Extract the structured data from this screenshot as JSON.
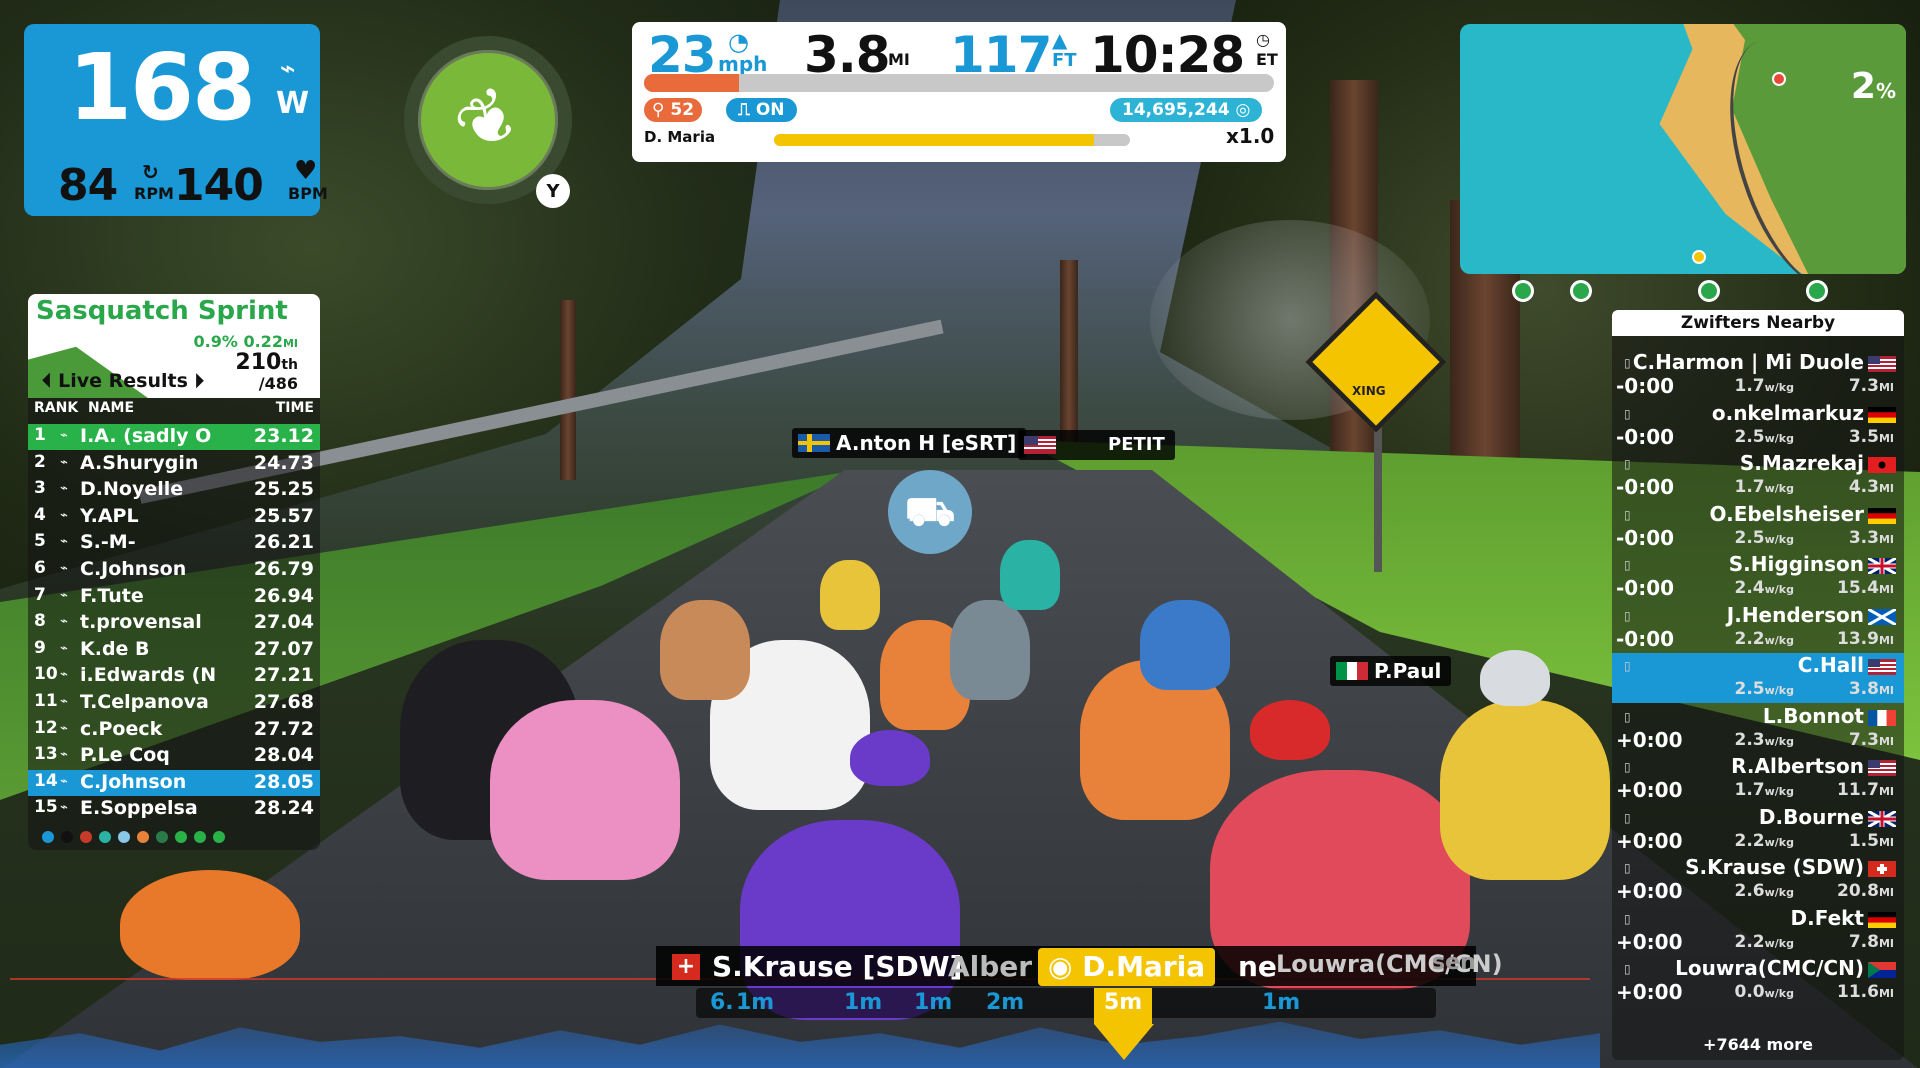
{
  "power": {
    "value": "168",
    "unit": "W",
    "cadence": "84",
    "cadence_unit": "RPM",
    "heart_rate": "140",
    "hr_unit": "BPM"
  },
  "powerup": {
    "key": "Y",
    "icon": "feather-icon"
  },
  "top": {
    "speed": "23",
    "speed_unit": "mph",
    "distance": "3.8",
    "distance_unit": "MI",
    "elevation": "117",
    "elevation_unit": "FT",
    "time": "10:28",
    "time_unit": "ET",
    "route_progress_pct": 15,
    "cadence_pill": "52",
    "steering": "ON",
    "xp": "14,695,244",
    "rider": "D. Maria",
    "level_progress_pct": 90,
    "multiplier": "x1.0"
  },
  "minimap": {
    "gradient": "2",
    "gradient_unit": "%"
  },
  "leaderboard": {
    "title": "Sasquatch Sprint",
    "segment_pct": "0.9%",
    "segment_dist": "0.22",
    "segment_dist_unit": "MI",
    "position": "210",
    "position_suffix": "th",
    "of_total": "/486",
    "live_label": "Live Results",
    "col_rank": "RANK",
    "col_name": "NAME",
    "col_time": "TIME",
    "rows": [
      {
        "rank": "1",
        "name": "I.A. (sadly O",
        "time": "23.12"
      },
      {
        "rank": "2",
        "name": "A.Shurygin",
        "time": "24.73"
      },
      {
        "rank": "3",
        "name": "D.Noyelle",
        "time": "25.25"
      },
      {
        "rank": "4",
        "name": "Y.APL",
        "time": "25.57"
      },
      {
        "rank": "5",
        "name": "S.-M-",
        "time": "26.21"
      },
      {
        "rank": "6",
        "name": "C.Johnson",
        "time": "26.79"
      },
      {
        "rank": "7",
        "name": "F.Tute",
        "time": "26.94"
      },
      {
        "rank": "8",
        "name": "t.provensal",
        "time": "27.04"
      },
      {
        "rank": "9",
        "name": "K.de B",
        "time": "27.07"
      },
      {
        "rank": "10",
        "name": "i.Edwards (N",
        "time": "27.21"
      },
      {
        "rank": "11",
        "name": "T.Celpanova",
        "time": "27.68"
      },
      {
        "rank": "12",
        "name": "c.Poeck",
        "time": "27.72"
      },
      {
        "rank": "13",
        "name": "P.Le Coq",
        "time": "28.04"
      },
      {
        "rank": "14",
        "name": "C.Johnson",
        "time": "28.05"
      },
      {
        "rank": "15",
        "name": "E.Soppelsa",
        "time": "28.24"
      }
    ]
  },
  "nearby": {
    "title": "Zwifters Nearby",
    "more": "+7644 more",
    "rows": [
      {
        "gap": "-0:00",
        "name": "C.Harmon | Mi Duole",
        "wkg": "1.7",
        "mi": "7.3",
        "flag": "us"
      },
      {
        "gap": "-0:00",
        "name": "o.nkelmarkuz",
        "wkg": "2.5",
        "mi": "3.5",
        "flag": "de"
      },
      {
        "gap": "-0:00",
        "name": "S.Mazrekaj",
        "wkg": "1.7",
        "mi": "4.3",
        "flag": "al"
      },
      {
        "gap": "-0:00",
        "name": "O.Ebelsheiser",
        "wkg": "2.5",
        "mi": "3.3",
        "flag": "de"
      },
      {
        "gap": "-0:00",
        "name": "S.Higginson",
        "wkg": "2.4",
        "mi": "15.4",
        "flag": "gb"
      },
      {
        "gap": "-0:00",
        "name": "J.Henderson",
        "wkg": "2.2",
        "mi": "13.9",
        "flag": "sc"
      },
      {
        "gap": "",
        "name": "C.Hall",
        "wkg": "2.5",
        "mi": "3.8",
        "flag": "us"
      },
      {
        "gap": "+0:00",
        "name": "L.Bonnot",
        "wkg": "2.3",
        "mi": "7.3",
        "flag": "fr"
      },
      {
        "gap": "+0:00",
        "name": "R.Albertson",
        "wkg": "1.7",
        "mi": "11.7",
        "flag": "us"
      },
      {
        "gap": "+0:00",
        "name": "D.Bourne",
        "wkg": "2.2",
        "mi": "1.5",
        "flag": "gb"
      },
      {
        "gap": "+0:00",
        "name": "S.Krause (SDW)",
        "wkg": "2.6",
        "mi": "20.8",
        "flag": "ch"
      },
      {
        "gap": "+0:00",
        "name": "D.Fekt",
        "wkg": "2.2",
        "mi": "7.8",
        "flag": "de"
      },
      {
        "gap": "+0:00",
        "name": "Louwra(CMC/CN)",
        "wkg": "0.0",
        "mi": "11.6",
        "flag": "za"
      }
    ],
    "wkg_unit": "w/kg",
    "mi_unit": "MI"
  },
  "tags": {
    "anton": "A.nton H [eSRT]",
    "petit": "PETIT",
    "ppaul": "P.Paul"
  },
  "sign": {
    "text": "XING"
  },
  "bottom": {
    "left_name": "S.Krause [SDW]",
    "left_name_tail": "Alber",
    "self": "D.Maria",
    "right_name": "ne",
    "right_name2": "Louwra(CMC/CN)",
    "right_tail": "sen",
    "dists": [
      "6.",
      "1m",
      "1m",
      "1m",
      "2m",
      "5m",
      "1m"
    ]
  },
  "colors": {
    "accent": "#1a98d6",
    "orange": "#e96a3a",
    "yellow": "#f5c400",
    "green": "#2ab24a"
  }
}
